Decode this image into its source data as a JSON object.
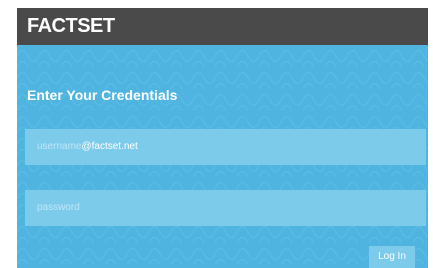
{
  "header": {
    "logo_text": "FACTSET"
  },
  "form": {
    "title": "Enter Your Credentials",
    "username": {
      "placeholder": "username",
      "domain_suffix": "@factset.net"
    },
    "password": {
      "placeholder": "password"
    },
    "login_label": "Log In"
  },
  "colors": {
    "header_bg": "#4a4a4a",
    "panel_bg": "#4fb5e0",
    "field_bg": "#7dcbeb",
    "text": "#ffffff"
  }
}
